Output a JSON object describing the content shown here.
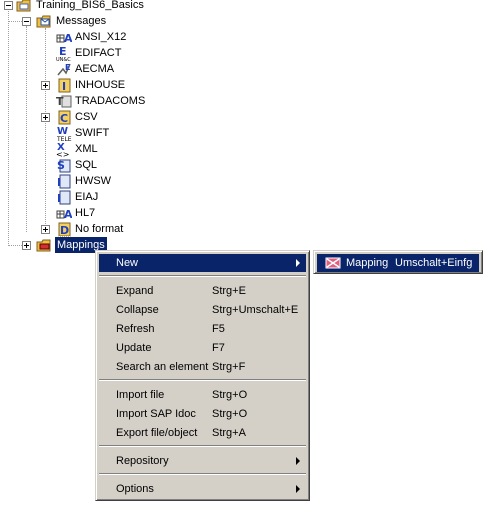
{
  "tree": {
    "root": {
      "label": "Training_BIS6_Basics",
      "icon": "project-folder-icon"
    },
    "messages": {
      "label": "Messages",
      "icon": "messages-folder-icon",
      "items": [
        {
          "label": "ANSI_X12",
          "icon": "ansi-format-icon",
          "expandable": false
        },
        {
          "label": "EDIFACT",
          "icon": "edifact-format-icon",
          "expandable": false
        },
        {
          "label": "AECMA",
          "icon": "aecma-format-icon",
          "expandable": false
        },
        {
          "label": "INHOUSE",
          "icon": "inhouse-format-icon",
          "expandable": true
        },
        {
          "label": "TRADACOMS",
          "icon": "tradacoms-format-icon",
          "expandable": false
        },
        {
          "label": "CSV",
          "icon": "csv-format-icon",
          "expandable": true
        },
        {
          "label": "SWIFT",
          "icon": "swift-format-icon",
          "expandable": false
        },
        {
          "label": "XML",
          "icon": "xml-format-icon",
          "expandable": false
        },
        {
          "label": "SQL",
          "icon": "sql-format-icon",
          "expandable": false
        },
        {
          "label": "HWSW",
          "icon": "hwsw-format-icon",
          "expandable": false
        },
        {
          "label": "EIAJ",
          "icon": "eiaj-format-icon",
          "expandable": false
        },
        {
          "label": "HL7",
          "icon": "hl7-format-icon",
          "expandable": false
        },
        {
          "label": "No format",
          "icon": "no-format-icon",
          "expandable": true
        }
      ]
    },
    "mappings": {
      "label": "Mappings",
      "icon": "mappings-folder-icon"
    }
  },
  "context_menu": {
    "new": {
      "label": "New"
    },
    "groups": [
      [
        {
          "label": "Expand",
          "shortcut": "Strg+E"
        },
        {
          "label": "Collapse",
          "shortcut": "Strg+Umschalt+E"
        },
        {
          "label": "Refresh",
          "shortcut": "F5"
        },
        {
          "label": "Update",
          "shortcut": "F7"
        },
        {
          "label": "Search an element",
          "shortcut": "Strg+F"
        }
      ],
      [
        {
          "label": "Import file",
          "shortcut": "Strg+O"
        },
        {
          "label": "Import SAP Idoc",
          "shortcut": "Strg+O"
        },
        {
          "label": "Export file/object",
          "shortcut": "Strg+A"
        }
      ]
    ],
    "repository": {
      "label": "Repository"
    },
    "options": {
      "label": "Options"
    }
  },
  "submenu": {
    "item": {
      "label": "Mapping",
      "shortcut": "Umschalt+Einfg",
      "icon": "mapping-icon"
    }
  },
  "colors": {
    "highlight": "#0a246a",
    "menu_bg": "#d4d0c8"
  }
}
